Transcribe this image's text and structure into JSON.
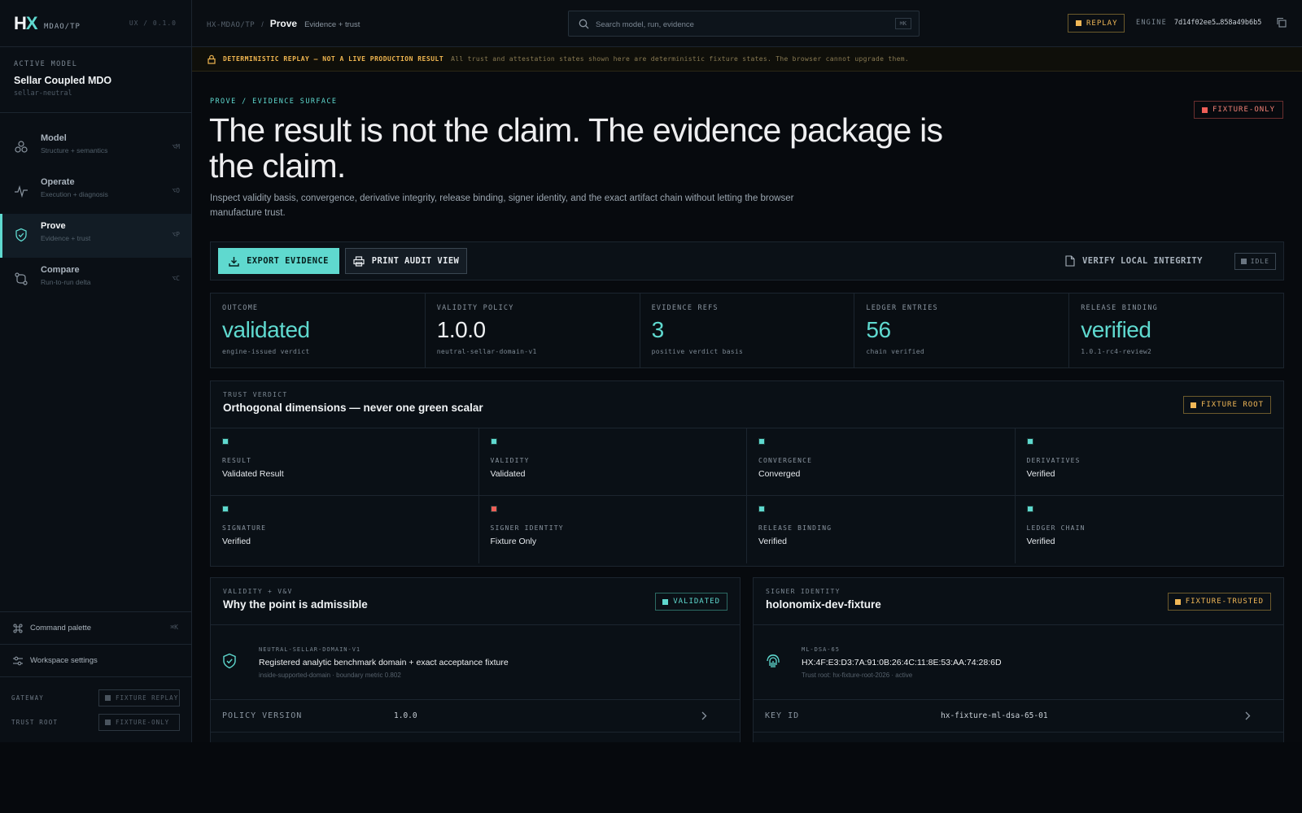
{
  "brand": {
    "logo_h": "H",
    "logo_x": "X",
    "sub": "MDAO/TP",
    "version": "UX / 0.1.0"
  },
  "active_model": {
    "label": "ACTIVE MODEL",
    "name": "Sellar Coupled MDO",
    "slug": "sellar-neutral"
  },
  "nav": [
    {
      "title": "Model",
      "sub": "Structure + semantics",
      "kbd": "⌥M",
      "icon": "molecule-icon"
    },
    {
      "title": "Operate",
      "sub": "Execution + diagnosis",
      "kbd": "⌥O",
      "icon": "pulse-icon"
    },
    {
      "title": "Prove",
      "sub": "Evidence + trust",
      "kbd": "⌥P",
      "icon": "shield-check-icon",
      "active": true
    },
    {
      "title": "Compare",
      "sub": "Run-to-run delta",
      "kbd": "⌥C",
      "icon": "compare-icon"
    }
  ],
  "sidebar_bottom": {
    "command_palette": "Command palette",
    "command_kbd": "⌘K",
    "settings": "Workspace settings",
    "status": [
      {
        "label": "GATEWAY",
        "value": "FIXTURE REPLAY"
      },
      {
        "label": "TRUST ROOT",
        "value": "FIXTURE-ONLY"
      }
    ]
  },
  "topbar": {
    "crumb_root": "HX-MDAO/TP",
    "crumb_sep": "/",
    "crumb_page": "Prove",
    "crumb_sub": "Evidence + trust",
    "search_placeholder": "Search model, run, evidence",
    "search_kbd": "⌘K",
    "replay": "REPLAY",
    "engine_label": "ENGINE",
    "engine_value": "7d14f02ee5…858a49b6b5"
  },
  "banner": {
    "title": "DETERMINISTIC REPLAY — NOT A LIVE PRODUCTION RESULT",
    "text": "All trust and attestation states shown here are deterministic fixture states. The browser cannot upgrade them."
  },
  "hero": {
    "eyebrow": "PROVE / EVIDENCE SURFACE",
    "badge": "FIXTURE-ONLY",
    "headline": "The result is not the claim. The evidence package is the claim.",
    "lede": "Inspect validity basis, convergence, derivative integrity, release binding, signer identity, and the exact artifact chain without letting the browser manufacture trust."
  },
  "actions": {
    "export": "EXPORT EVIDENCE",
    "print": "PRINT AUDIT VIEW",
    "verify": "VERIFY LOCAL INTEGRITY",
    "status": "IDLE"
  },
  "metrics": [
    {
      "label": "OUTCOME",
      "value": "validated",
      "sub": "engine-issued verdict",
      "tone": "teal"
    },
    {
      "label": "VALIDITY POLICY",
      "value": "1.0.0",
      "sub": "neutral-sellar-domain-v1",
      "tone": "white"
    },
    {
      "label": "EVIDENCE REFS",
      "value": "3",
      "sub": "positive verdict basis",
      "tone": "teal"
    },
    {
      "label": "LEDGER ENTRIES",
      "value": "56",
      "sub": "chain verified",
      "tone": "teal"
    },
    {
      "label": "RELEASE BINDING",
      "value": "verified",
      "sub": "1.0.1-rc4-review2",
      "tone": "teal"
    }
  ],
  "trust": {
    "eyebrow": "TRUST VERDICT",
    "title": "Orthogonal dimensions — never one green scalar",
    "badge": "FIXTURE ROOT",
    "cells": [
      {
        "label": "RESULT",
        "value": "Validated Result",
        "status": "ok"
      },
      {
        "label": "VALIDITY",
        "value": "Validated",
        "status": "ok"
      },
      {
        "label": "CONVERGENCE",
        "value": "Converged",
        "status": "ok"
      },
      {
        "label": "DERIVATIVES",
        "value": "Verified",
        "status": "ok"
      },
      {
        "label": "SIGNATURE",
        "value": "Verified",
        "status": "ok"
      },
      {
        "label": "SIGNER IDENTITY",
        "value": "Fixture Only",
        "status": "warn"
      },
      {
        "label": "RELEASE BINDING",
        "value": "Verified",
        "status": "ok"
      },
      {
        "label": "LEDGER CHAIN",
        "value": "Verified",
        "status": "ok"
      }
    ]
  },
  "validity": {
    "eyebrow": "VALIDITY + V&V",
    "title": "Why the point is admissible",
    "badge": "VALIDATED",
    "body_tag": "NEUTRAL-SELLAR-DOMAIN-V1",
    "body_title": "Registered analytic benchmark domain + exact acceptance fixture",
    "body_sub": "inside-supported-domain · boundary metric 0.802",
    "row_label": "POLICY VERSION",
    "row_value": "1.0.0"
  },
  "signer": {
    "eyebrow": "SIGNER IDENTITY",
    "title": "holonomix-dev-fixture",
    "badge": "FIXTURE-TRUSTED",
    "body_tag": "ML-DSA-65",
    "body_title": "HX:4F:E3:D3:7A:91:0B:26:4C:11:8E:53:AA:74:28:6D",
    "body_sub": "Trust root: hx-fixture-root-2026 · active",
    "row_label": "KEY ID",
    "row_value": "hx-fixture-ml-dsa-65-01"
  },
  "colors": {
    "accent": "#5fd9cf",
    "warn": "#f1b857",
    "danger": "#ef5f58",
    "bg": "#070a0e"
  }
}
